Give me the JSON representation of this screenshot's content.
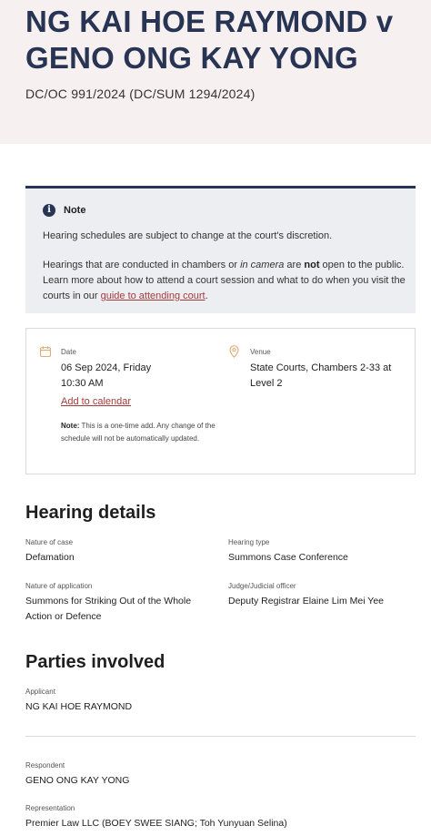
{
  "header": {
    "title": "NG KAI HOE RAYMOND v GENO ONG KAY YONG",
    "case_number": "DC/OC 991/2024 (DC/SUM 1294/2024)"
  },
  "note": {
    "heading": "Note",
    "para1": "Hearing schedules are subject to change at the court's discretion.",
    "para2_a": "Hearings that are conducted in chambers or ",
    "para2_em": "in camera",
    "para2_b": " are ",
    "para2_strong": "not",
    "para2_c": " open to the public. Learn more about how to attend a court session and what to do when you visit the courts in our ",
    "link_text": "guide to attending court",
    "para2_end": "."
  },
  "schedule": {
    "date_label": "Date",
    "date": "06 Sep 2024, Friday",
    "time": "10:30 AM",
    "add_calendar": "Add to calendar",
    "note_label": "Note:",
    "note_text": " This is a one-time add. Any change of the schedule will not be automatically updated.",
    "venue_label": "Venue",
    "venue_line1": "State Courts, Chambers 2-33 at",
    "venue_line2": "Level 2"
  },
  "hearing_details": {
    "heading": "Hearing details",
    "nature_case_label": "Nature of case",
    "nature_case": "Defamation",
    "hearing_type_label": "Hearing type",
    "hearing_type": "Summons Case Conference",
    "nature_app_label": "Nature of application",
    "nature_app_line1": "Summons for Striking Out of the Whole",
    "nature_app_line2": "Action or Defence",
    "judge_label": "Judge/Judicial officer",
    "judge": "Deputy Registrar Elaine Lim Mei Yee"
  },
  "parties": {
    "heading": "Parties involved",
    "applicant_label": "Applicant",
    "applicant": "NG KAI HOE RAYMOND",
    "respondent_label": "Respondent",
    "respondent": "GENO ONG KAY YONG",
    "representation_label": "Representation",
    "representation": "Premier Law LLC (BOEY SWEE SIANG; Toh Yunyuan Selina)"
  },
  "colors": {
    "title": "#283453",
    "link": "#a33b3b",
    "icon": "#d9a56a",
    "hero_bg": "#f7f0f0",
    "note_bg": "#eceef2"
  },
  "icons": [
    "info-icon",
    "calendar-icon",
    "location-pin-icon"
  ]
}
